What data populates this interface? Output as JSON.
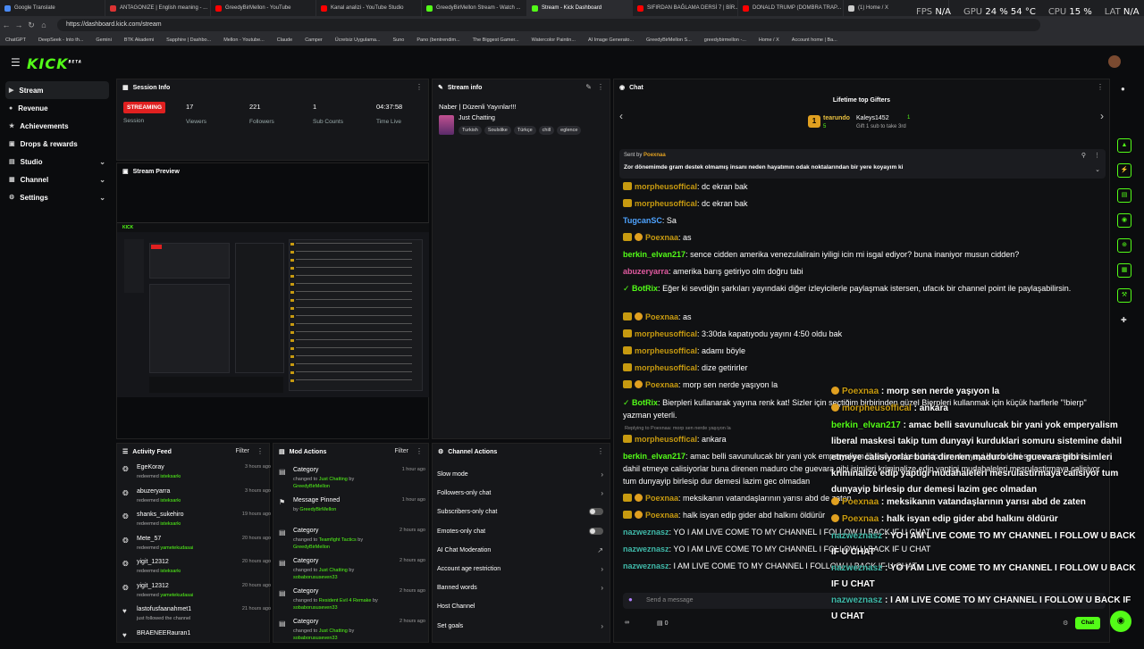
{
  "browser": {
    "tabs": [
      "Google Translate",
      "ANTAGONIZE | English meaning - ...",
      "GreedyBirMellon - YouTube",
      "Kanal analizi - YouTube Studio",
      "GreedyBirMellon Stream - Watch ...",
      "Stream - Kick Dashboard",
      "SIFIRDAN BAĞLAMA DERSİ 7 | BİR...",
      "DONALD TRUMP (DOMBRA TRAP...",
      "(1) Home / X"
    ],
    "url": "https://dashboard.kick.com/stream",
    "bookmarks": [
      "ChatGPT",
      "DeepSeek - Into th...",
      "Gemini",
      "BTK Akademi",
      "Sapphire | Dashbo...",
      "Mellon - Youtube...",
      "Claude",
      "Camper",
      "Ücretsiz Uygulama...",
      "Suno",
      "Pano (bentrendim...",
      "The Biggest Gamer...",
      "Watercolor Paintin...",
      "AI Image Generato...",
      "GreedyBirMellon S...",
      "greedybirmellon -...",
      "Home / X",
      "Account home | Ba..."
    ]
  },
  "hud": {
    "fps_label": "FPS",
    "fps": "N/A",
    "gpu_label": "GPU",
    "gpu": "24 % 54 °C",
    "cpu_label": "CPU",
    "cpu": "15 %",
    "lat_label": "LAT",
    "lat": "N/A"
  },
  "brand": {
    "logo": "KICK",
    "beta": "BETA"
  },
  "sidebar": [
    {
      "label": "Stream",
      "icon": "video-icon"
    },
    {
      "label": "Revenue",
      "icon": "coin-icon"
    },
    {
      "label": "Achievements",
      "icon": "trophy-icon"
    },
    {
      "label": "Drops & rewards",
      "icon": "gift-icon"
    },
    {
      "label": "Studio",
      "icon": "layers-icon"
    },
    {
      "label": "Channel",
      "icon": "channel-icon"
    },
    {
      "label": "Settings",
      "icon": "gear-icon"
    }
  ],
  "session": {
    "title": "Session Info",
    "status": "STREAMING",
    "status_label": "Session",
    "viewers": "17",
    "viewers_label": "Viewers",
    "followers": "221",
    "followers_label": "Followers",
    "subs": "1",
    "subs_label": "Sub Counts",
    "time": "04:37:58",
    "time_label": "Time Live"
  },
  "preview": {
    "title": "Stream Preview"
  },
  "stream_info": {
    "title": "Stream info",
    "stream_title": "Naber | Düzenli Yayınlar!!!",
    "category": "Just Chatting",
    "tags": [
      "Turkish",
      "Soulslike",
      "Türkçe",
      "chill",
      "eglence"
    ]
  },
  "activity": {
    "title": "Activity Feed",
    "filter": "Filter",
    "rows": [
      {
        "user": "EgeKoray",
        "action": "redeemed",
        "reward": "isteksarkı",
        "time": "3 hours ago"
      },
      {
        "user": "abuzeryarra",
        "action": "redeemed",
        "reward": "isteksarkı",
        "time": "3 hours ago"
      },
      {
        "user": "shanks_sukehiro",
        "action": "redeemed",
        "reward": "isteksarkı",
        "time": "19 hours ago"
      },
      {
        "user": "Mete_57",
        "action": "redeemed",
        "reward": "yametekudasai",
        "time": "20 hours ago"
      },
      {
        "user": "yigit_12312",
        "action": "redeemed",
        "reward": "isteksarkı",
        "time": "20 hours ago"
      },
      {
        "user": "yigit_12312",
        "action": "redeemed",
        "reward": "yametekudasai",
        "time": "20 hours ago"
      },
      {
        "user": "lastofusfaanahmet1",
        "action": "just followed the channel",
        "reward": "",
        "time": "21 hours ago"
      },
      {
        "user": "BRAENEERauran1",
        "action": "",
        "reward": "",
        "time": ""
      }
    ]
  },
  "mod": {
    "title": "Mod Actions",
    "filter": "Filter",
    "rows": [
      {
        "title": "Category",
        "pre": "changed to",
        "val": "Just Chatting",
        "by": "by",
        "who": "GreedyBirMellon",
        "time": "1 hour ago"
      },
      {
        "title": "Message Pinned",
        "pre": "",
        "val": "",
        "by": "by",
        "who": "GreedyBirMellon",
        "time": "1 hour ago"
      },
      {
        "title": "Category",
        "pre": "changed to",
        "val": "Teamfight Tactics",
        "by": "by",
        "who": "GreedyBirMellon",
        "time": "2 hours ago"
      },
      {
        "title": "Category",
        "pre": "changed to",
        "val": "Just Chatting",
        "by": "by",
        "who": "sobaborususeven33",
        "time": "2 hours ago"
      },
      {
        "title": "Category",
        "pre": "changed to",
        "val": "Resident Evil 4 Remake",
        "by": "by",
        "who": "sobaborususeven33",
        "time": "2 hours ago"
      },
      {
        "title": "Category",
        "pre": "changed to",
        "val": "Just Chatting",
        "by": "by",
        "who": "sobaborususeven33",
        "time": "2 hours ago"
      }
    ]
  },
  "channel_actions": {
    "title": "Channel Actions",
    "rows": [
      "Slow mode",
      "Followers-only chat",
      "Subscribers-only chat",
      "Emotes-only chat",
      "AI Chat Moderation",
      "Account age restriction",
      "Banned words",
      "Host Channel",
      "Set goals"
    ]
  },
  "chat": {
    "title": "Chat",
    "gifters_title": "Lifetime top Gifters",
    "gifter1": "tearundo",
    "gifter1_count": "5",
    "gifter2": "Kaleys1452",
    "gifter2_count": "1",
    "gift_hint": "Gift 1 sub to take 3rd",
    "pinned_by": "Sent by",
    "pinned_user": "Poexnaa",
    "pinned_text": "Zor dönemimde gram destek olmamış insanı neden hayatımın odak noktalarından bir yere koyayım ki",
    "reply_hint": "Replying to Poexnaa: morp sen nerde yaşıyon la",
    "messages": [
      {
        "user": "morpheusoffical",
        "color": "#c79a10",
        "text": "dc ekran bak"
      },
      {
        "user": "morpheusoffical",
        "color": "#c79a10",
        "text": "dc ekran bak"
      },
      {
        "user": "TugcanSC",
        "color": "#4ea3ff",
        "text": "Sa"
      },
      {
        "user": "Poexnaa",
        "color": "#c79a10",
        "text": "as"
      },
      {
        "user": "berkin_elvan217",
        "color": "#53fc18",
        "text": "sence cidden amerika venezulalirain iyiligi icin mi isgal ediyor? buna inaniyor musun cidden?"
      },
      {
        "user": "abuzeryarra",
        "color": "#e05aa0",
        "text": "amerika barış getiriyo olm doğru tabi"
      },
      {
        "user": "BotRix",
        "color": "#53fc18",
        "text": "Eğer ki sevdiğin şarkıları yayındaki diğer izleyicilerle paylaşmak istersen, ufacık bir channel point ile paylaşabilirsin."
      },
      {
        "user": "Poexnaa",
        "color": "#c79a10",
        "text": "as"
      },
      {
        "user": "morpheusoffical",
        "color": "#c79a10",
        "text": "3:30da kapatıyodu yayını 4:50 oldu bak"
      },
      {
        "user": "morpheusoffical",
        "color": "#c79a10",
        "text": "adamı böyle"
      },
      {
        "user": "morpheusoffical",
        "color": "#c79a10",
        "text": "dize getirirler"
      },
      {
        "user": "Poexnaa",
        "color": "#c79a10",
        "text": "morp sen nerde yaşıyon la"
      },
      {
        "user": "BotRix",
        "color": "#53fc18",
        "text": "Bierpleri kullanarak yayına renk kat! Sizler için seçtiğim birbirinden güzel Bierpleri kullanmak için küçük harflerle \"!bierp\" yazman yeterli."
      },
      {
        "user": "morpheusoffical",
        "color": "#c79a10",
        "text": "ankara"
      },
      {
        "user": "berkin_elvan217",
        "color": "#53fc18",
        "text": "amac belli savunulucak bir yani yok emperyalism liberal maskesi takip tum dunyayi kurduklari somuru sistemine dahil etmeye calisiyorlar buna direnen maduro che guevara gibi isimleri kriminalize edip yaptigi mudahaleleri mesrulastirmaya calisiyor tum dunyayip birlesip dur demesi lazim gec olmadan"
      },
      {
        "user": "Poexnaa",
        "color": "#c79a10",
        "text": "meksikanın vatandaşlarının yarısı abd de zaten"
      },
      {
        "user": "Poexnaa",
        "color": "#c79a10",
        "text": "halk isyan edip gider abd halkını öldürür"
      },
      {
        "user": "nazweznasz",
        "color": "#3fb8a8",
        "text": "YO I AM LIVE COME TO MY CHANNEL I FOLLOW U BACK IF U CHAT"
      },
      {
        "user": "nazweznasz",
        "color": "#3fb8a8",
        "text": "YO I AM LIVE COME TO MY CHANNEL I FOLLOW U BACK IF U CHAT"
      },
      {
        "user": "nazweznasz",
        "color": "#3fb8a8",
        "text": "I AM LIVE COME TO MY CHANNEL I FOLLOW U BACK IF U CHAT"
      }
    ],
    "input_placeholder": "Send a message",
    "points": "0",
    "send": "Chat"
  },
  "overlay": [
    {
      "user": "Poexnaa",
      "color": "#c79a10",
      "text": "morp sen nerde yaşıyon la"
    },
    {
      "user": "morpheusoffical",
      "color": "#c79a10",
      "text": "ankara"
    },
    {
      "user": "berkin_elvan217",
      "color": "#53fc18",
      "text": "amac belli savunulucak bir yani yok emperyalism liberal maskesi takip tum dunyayi kurduklari somuru sistemine dahil etmeye calisiyorlar buna direnen maduro che guevara gibi isimleri kriminalize edip yaptigi mudahaleleri mesrulastirmaya calisiyor tum dunyayip birlesip dur demesi lazim gec olmadan"
    },
    {
      "user": "Poexnaa",
      "color": "#c79a10",
      "text": "meksikanın vatandaşlarının yarısı abd de zaten"
    },
    {
      "user": "Poexnaa",
      "color": "#c79a10",
      "text": "halk isyan edip gider abd halkını öldürür"
    },
    {
      "user": "nazweznasz",
      "color": "#3fb8a8",
      "text": "YO I AM LIVE COME TO MY CHANNEL I FOLLOW U BACK IF U CHAT"
    },
    {
      "user": "nazweznasz",
      "color": "#3fb8a8",
      "text": "YO I AM LIVE COME TO MY CHANNEL I FOLLOW U BACK IF U CHAT"
    },
    {
      "user": "nazweznasz",
      "color": "#3fb8a8",
      "text": "I AM LIVE COME TO MY CHANNEL I FOLLOW U BACK IF U CHAT"
    }
  ]
}
